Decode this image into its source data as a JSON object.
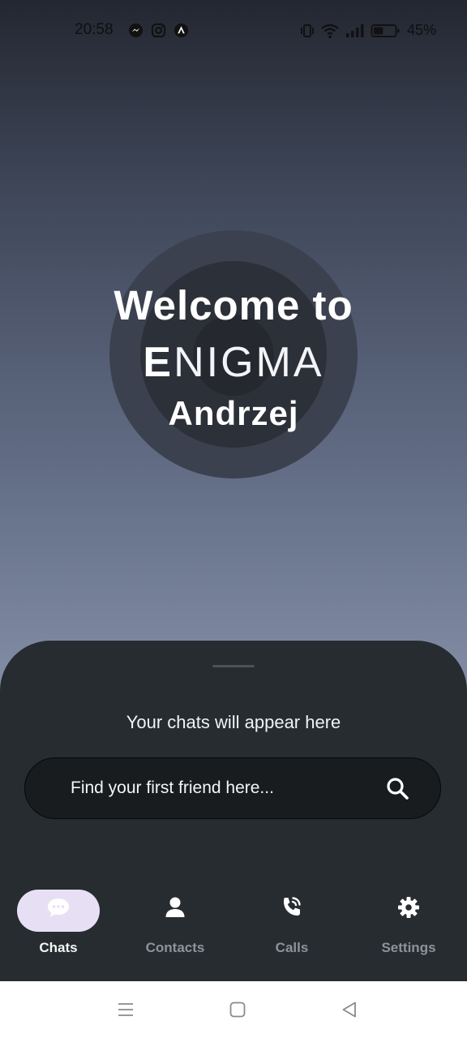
{
  "status_bar": {
    "time": "20:58",
    "battery_percent": "45%",
    "battery_level": 0.45,
    "notification_icons": [
      "messenger-icon",
      "instagram-icon",
      "app-icon"
    ],
    "system_icons": [
      "vibrate-icon",
      "wifi-icon",
      "signal-icon",
      "battery-icon"
    ]
  },
  "welcome": {
    "line1": "Welcome to",
    "brand_first": "E",
    "brand_rest": "NIGMA",
    "user_name": "Andrzej"
  },
  "sheet": {
    "empty_message": "Your chats will appear here",
    "search": {
      "placeholder": "Find your first friend here...",
      "value": ""
    }
  },
  "nav": {
    "items": [
      {
        "label": "Chats",
        "icon": "chat-bubble-icon",
        "active": true
      },
      {
        "label": "Contacts",
        "icon": "person-icon",
        "active": false
      },
      {
        "label": "Calls",
        "icon": "phone-call-icon",
        "active": false
      },
      {
        "label": "Settings",
        "icon": "gear-icon",
        "active": false
      }
    ]
  },
  "system_nav": {
    "buttons": [
      "menu-icon",
      "home-icon",
      "back-icon"
    ]
  },
  "colors": {
    "sheet_background": "#262c30",
    "active_nav_pill": "#e7e0f5",
    "inactive_nav_label": "#8d9398"
  }
}
